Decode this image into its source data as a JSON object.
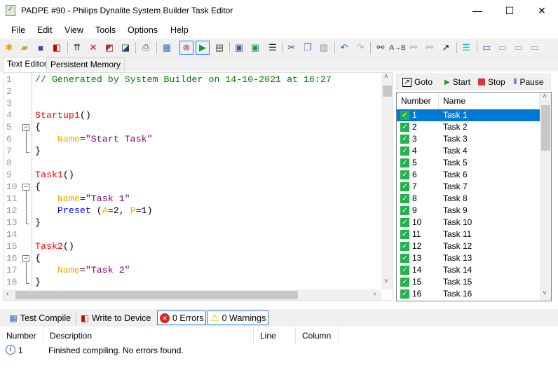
{
  "window": {
    "title": "PADPE #90 - Philips Dynalite System Builder Task Editor",
    "minimize": "—",
    "maximize": "☐",
    "close": "✕"
  },
  "menu": [
    "File",
    "Edit",
    "View",
    "Tools",
    "Options",
    "Help"
  ],
  "toolbar_icons": [
    "new-file-icon",
    "open-folder-icon",
    "save-icon",
    "write-device-icon",
    "device-upload-icon",
    "delete-icon",
    "copy-device-icon",
    "edit-device-icon",
    "print-icon",
    "test-compile-icon",
    "stop-task-icon",
    "start-task-icon",
    "task-list-icon",
    "device-icon",
    "device-green-icon",
    "list-icon",
    "cut-icon",
    "copy-icon",
    "paste-icon",
    "undo-icon",
    "redo-icon",
    "find-icon",
    "replace-icon",
    "find-next-icon",
    "find-prev-icon",
    "goto-icon",
    "indent-icon",
    "comment-icon",
    "bubble-right-icon",
    "bubble-left-icon",
    "bubble-remove-icon"
  ],
  "tabs": [
    "Text Editor",
    "Persistent Memory"
  ],
  "editor": {
    "line_numbers": [
      "1",
      "2",
      "3",
      "4",
      "5",
      "6",
      "7",
      "8",
      "9",
      "10",
      "11",
      "12",
      "13",
      "14",
      "15",
      "16",
      "17",
      "18"
    ],
    "lines": [
      [
        [
          "c-com",
          "// Generated by System Builder on 14-10-2021 at 16:27"
        ]
      ],
      [],
      [],
      [
        [
          "c-fn",
          "Startup1"
        ],
        [
          "",
          "()"
        ]
      ],
      [
        [
          "",
          "{"
        ]
      ],
      [
        [
          "",
          "    "
        ],
        [
          "c-key",
          "Name"
        ],
        [
          "",
          "="
        ],
        [
          "c-str",
          "\"Start Task\""
        ]
      ],
      [
        [
          "",
          "}"
        ]
      ],
      [],
      [
        [
          "c-fn",
          "Task1"
        ],
        [
          "",
          "()"
        ]
      ],
      [
        [
          "",
          "{"
        ]
      ],
      [
        [
          "",
          "    "
        ],
        [
          "c-key",
          "Name"
        ],
        [
          "",
          "="
        ],
        [
          "c-str",
          "\"Task 1\""
        ]
      ],
      [
        [
          "",
          "    "
        ],
        [
          "c-kw",
          "Preset"
        ],
        [
          "",
          " ("
        ],
        [
          "c-key",
          "A"
        ],
        [
          "",
          "=2, "
        ],
        [
          "c-key",
          "P"
        ],
        [
          "",
          "=1)"
        ]
      ],
      [
        [
          "",
          "}"
        ]
      ],
      [],
      [
        [
          "c-fn",
          "Task2"
        ],
        [
          "",
          "()"
        ]
      ],
      [
        [
          "",
          "{"
        ]
      ],
      [
        [
          "",
          "    "
        ],
        [
          "c-key",
          "Name"
        ],
        [
          "",
          "="
        ],
        [
          "c-str",
          "\"Task 2\""
        ]
      ],
      [
        [
          "",
          "}"
        ]
      ]
    ]
  },
  "task_panel": {
    "goto": "Goto",
    "start": "Start",
    "stop": "Stop",
    "pause": "Pause",
    "columns": [
      "Number",
      "Name"
    ],
    "tasks": [
      [
        "1",
        "Task 1"
      ],
      [
        "2",
        "Task 2"
      ],
      [
        "3",
        "Task 3"
      ],
      [
        "4",
        "Task 4"
      ],
      [
        "5",
        "Task 5"
      ],
      [
        "6",
        "Task 6"
      ],
      [
        "7",
        "Task 7"
      ],
      [
        "8",
        "Task 8"
      ],
      [
        "9",
        "Task 9"
      ],
      [
        "10",
        "Task 10"
      ],
      [
        "11",
        "Task 11"
      ],
      [
        "12",
        "Task 12"
      ],
      [
        "13",
        "Task 13"
      ],
      [
        "14",
        "Task 14"
      ],
      [
        "15",
        "Task 15"
      ],
      [
        "16",
        "Task 16"
      ]
    ],
    "selected": "1"
  },
  "bottom_toolbar": {
    "test_compile": "Test Compile",
    "write_to_device": "Write to Device",
    "errors": "0 Errors",
    "warnings": "0 Warnings"
  },
  "results": {
    "columns": [
      "Number",
      "Description",
      "Line",
      "Column"
    ],
    "rows": [
      {
        "number": "1",
        "description": "Finished compiling. No errors found.",
        "line": "",
        "column": ""
      }
    ]
  }
}
